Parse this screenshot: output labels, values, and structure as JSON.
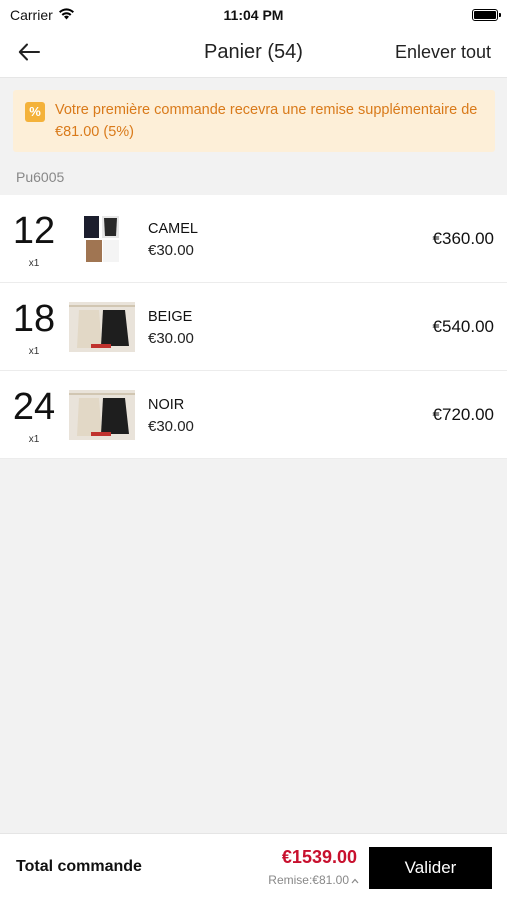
{
  "status_bar": {
    "carrier": "Carrier",
    "time": "11:04 PM"
  },
  "nav": {
    "title": "Panier (54)",
    "action_label": "Enlever tout"
  },
  "promo": {
    "icon": "percent-icon",
    "text": "Votre première commande recevra une remise supplémentaire de €81.00 (5%)"
  },
  "group": {
    "label": "Pu6005"
  },
  "items": [
    {
      "qty": "12",
      "multiplier": "x1",
      "variant": "CAMEL",
      "unit_price": "€30.00",
      "total": "€360.00"
    },
    {
      "qty": "18",
      "multiplier": "x1",
      "variant": "BEIGE",
      "unit_price": "€30.00",
      "total": "€540.00"
    },
    {
      "qty": "24",
      "multiplier": "x1",
      "variant": "NOIR",
      "unit_price": "€30.00",
      "total": "€720.00"
    }
  ],
  "footer": {
    "total_label": "Total commande",
    "total_amount": "€1539.00",
    "discount": "Remise:€81.00",
    "validate_label": "Valider"
  },
  "colors": {
    "accent_red": "#c8102e",
    "promo_bg": "#fdefd8",
    "promo_text": "#d97a1a",
    "button_bg": "#000000"
  }
}
